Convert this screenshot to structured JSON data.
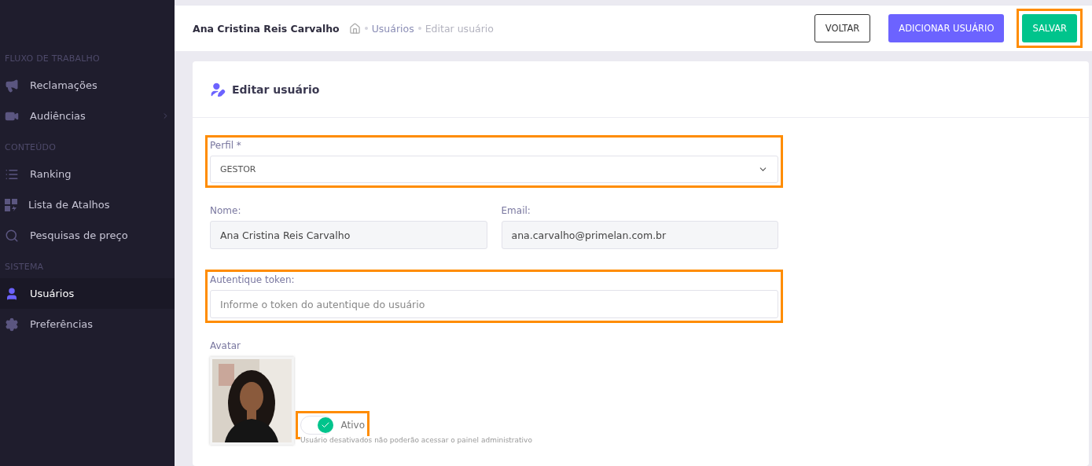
{
  "sidebar": {
    "sections": [
      {
        "title": "FLUXO DE TRABALHO",
        "items": [
          {
            "label": "Reclamações",
            "selected": false,
            "has_submenu": false
          },
          {
            "label": "Audiências",
            "selected": false,
            "has_submenu": true
          }
        ]
      },
      {
        "title": "CONTEÚDO",
        "items": [
          {
            "label": "Ranking",
            "selected": false,
            "has_submenu": false
          },
          {
            "label": "Lista de Atalhos",
            "selected": false,
            "has_submenu": false
          },
          {
            "label": "Pesquisas de preço",
            "selected": false,
            "has_submenu": false
          }
        ]
      },
      {
        "title": "SISTEMA",
        "items": [
          {
            "label": "Usuários",
            "selected": true,
            "has_submenu": false
          },
          {
            "label": "Preferências",
            "selected": false,
            "has_submenu": false
          }
        ]
      }
    ]
  },
  "header": {
    "title": "Ana Cristina Reis Carvalho",
    "breadcrumb": [
      {
        "label": "Usuários",
        "link": true
      },
      {
        "label": "Editar usuário",
        "link": false
      }
    ],
    "buttons": [
      {
        "label": "VOLTAR",
        "kind": "outline",
        "highlighted": false
      },
      {
        "label": "ADICIONAR USUÁRIO",
        "kind": "primary",
        "highlighted": false
      },
      {
        "label": "SALVAR",
        "kind": "success",
        "highlighted": true
      }
    ]
  },
  "card": {
    "title": "Editar usuário",
    "profile": {
      "label": "Perfil *",
      "value": "GESTOR",
      "highlighted": true
    },
    "name": {
      "label": "Nome:",
      "value": "Ana Cristina Reis Carvalho"
    },
    "email": {
      "label": "Email:",
      "value": "ana.carvalho@primelan.com.br"
    },
    "token": {
      "label": "Autentique token:",
      "placeholder": "Informe o token do autentique do usuário",
      "highlighted": true
    },
    "avatar": {
      "label": "Avatar",
      "kind": "picture"
    },
    "active": {
      "label": "Ativo",
      "on": true,
      "highlighted": true,
      "hint": "Usuário desativados não poderão acessar o painel administrativo"
    }
  }
}
